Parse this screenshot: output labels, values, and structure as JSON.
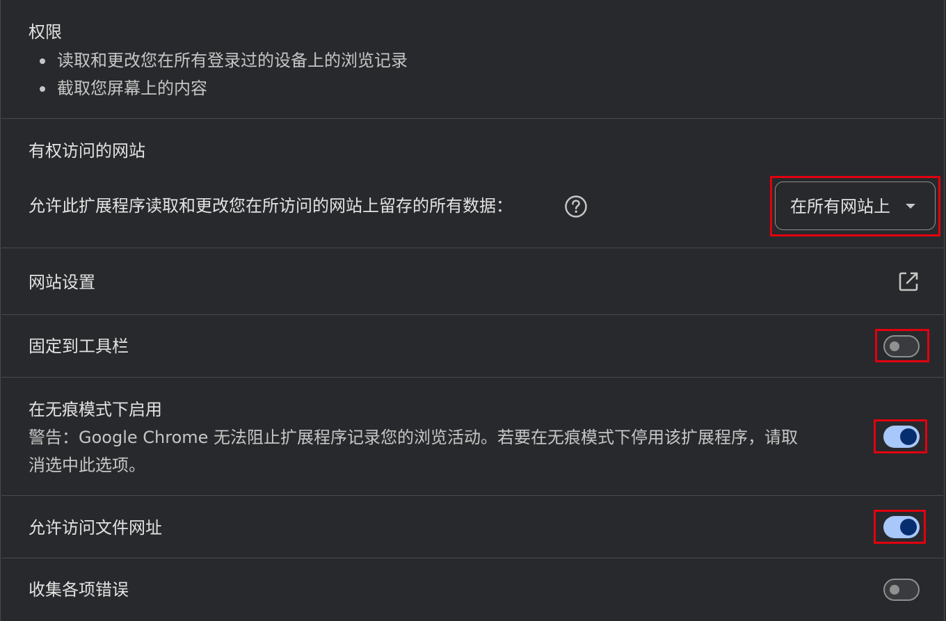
{
  "permissions": {
    "title": "权限",
    "items": [
      "读取和更改您在所有登录过的设备上的浏览记录",
      "截取您屏幕上的内容"
    ]
  },
  "site_access": {
    "title": "有权访问的网站",
    "description": "允许此扩展程序读取和更改您在所访问的网站上留存的所有数据：",
    "help_icon": "help-circle-icon",
    "select_value": "在所有网站上"
  },
  "site_settings": {
    "label": "网站设置",
    "icon": "open-in-new-icon"
  },
  "pin_toolbar": {
    "label": "固定到工具栏",
    "enabled": false
  },
  "incognito": {
    "label": "在无痕模式下启用",
    "warning_line1": "警告：Google Chrome 无法阻止扩展程序记录您的浏览活动。若要在无痕模式下停用该扩展程序，请取",
    "warning_line2": "消选中此选项。",
    "enabled": true
  },
  "file_urls": {
    "label": "允许访问文件网址",
    "enabled": true
  },
  "collect_errors": {
    "label": "收集各项错误",
    "enabled": false
  },
  "colors": {
    "background": "#28292c",
    "divider": "#4a4b4e",
    "toggle_on_track": "#a8c7fa",
    "toggle_on_knob": "#062e6f",
    "highlight": "#e3000f"
  }
}
